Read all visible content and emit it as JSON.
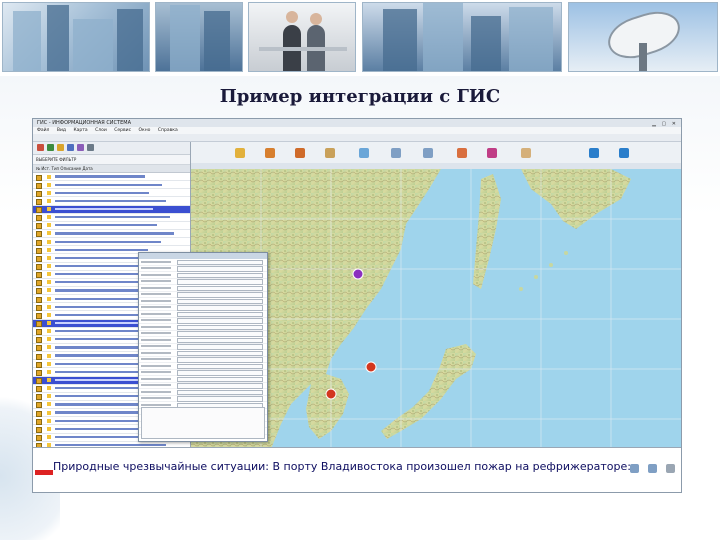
{
  "slide": {
    "title": "Пример интеграции с ГИС"
  },
  "app": {
    "window_title": "ГИС - ИНФОРМАЦИОННАЯ СИСТЕМА",
    "menu": [
      "Файл",
      "Вид",
      "Карта",
      "Слои",
      "Сервис",
      "Окно",
      "Справка"
    ],
    "left_panel": {
      "combo": "ВЫБЕРИТЕ ФИЛЬТР",
      "header": "№  Ист.  Тип  Описание        Дата"
    }
  },
  "ticker": {
    "text": "Природные чрезвычайные ситуации: В порту Владивостока произошел пожар на рефрижераторе:"
  },
  "colors": {
    "accent": "#3b4fd1",
    "ticker": "#0d0d60",
    "marker_red": "#d3371f",
    "marker_purple": "#8b2fbf"
  },
  "icons": [
    "grid-icon",
    "refresh-icon",
    "filter-icon",
    "pencil-icon",
    "zoom-in-icon",
    "zoom-out-icon",
    "hand-icon",
    "back-icon",
    "forward-icon",
    "home-icon",
    "save-icon",
    "print-icon"
  ]
}
